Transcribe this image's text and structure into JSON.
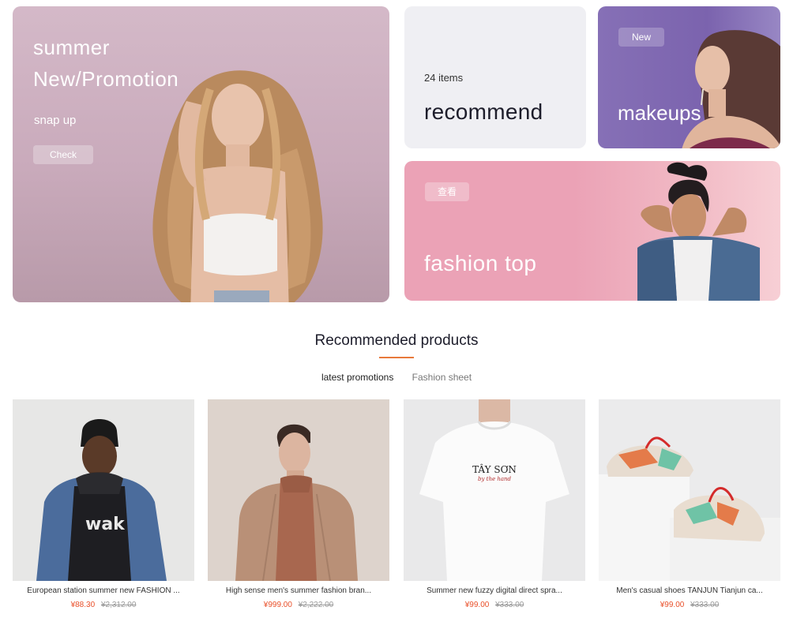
{
  "banners": {
    "summer": {
      "title_line1": "summer",
      "title_line2": "New/Promotion",
      "subtitle": "snap up",
      "button": "Check"
    },
    "recommend": {
      "count": "24 items",
      "title": "recommend"
    },
    "makeups": {
      "badge": "New",
      "title": "makeups"
    },
    "fashion_top": {
      "badge": "查看",
      "title": "fashion top"
    }
  },
  "section": {
    "title": "Recommended products",
    "tabs": [
      {
        "label": "latest promotions",
        "active": true
      },
      {
        "label": "Fashion sheet",
        "active": false
      }
    ]
  },
  "products": [
    {
      "name": "European station summer new FASHION ...",
      "price": "¥88.30",
      "old_price": "¥2,312.00"
    },
    {
      "name": "High sense men's summer fashion bran...",
      "price": "¥999.00",
      "old_price": "¥2,222.00"
    },
    {
      "name": "Summer new fuzzy digital direct spra...",
      "price": "¥99.00",
      "old_price": "¥333.00"
    },
    {
      "name": "Men's casual shoes TANJUN Tianjun ca...",
      "price": "¥99.00",
      "old_price": "¥333.00"
    }
  ],
  "tshirt_print": {
    "line1": "TÂY SƠN",
    "line2": "by the hand"
  },
  "colors": {
    "accent_line": "#e8793b",
    "price": "#e9502a",
    "summer_bg": "#d4b9c8",
    "makeups_bg": "#8670b6",
    "fashion_bg": "#eba2b6",
    "recommend_bg": "#efeff3"
  }
}
